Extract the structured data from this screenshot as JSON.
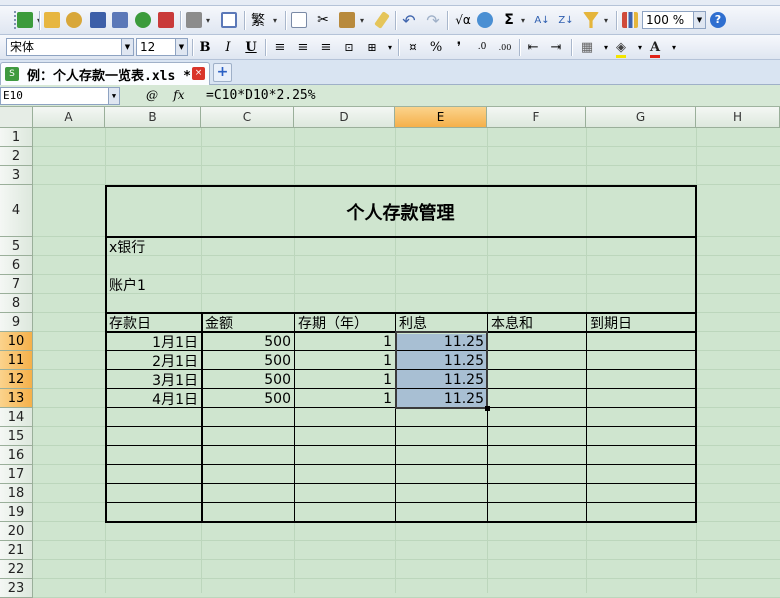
{
  "toolbar": {
    "zoom": "100 %",
    "text_style_btn": "繁",
    "sum_btn": "Σ"
  },
  "format": {
    "font_name": "宋体",
    "font_size": "12",
    "bold": "B",
    "italic": "I",
    "underline": "U",
    "percent": "%",
    "inc_decimal": ".0",
    "dec_decimal": ".00",
    "font_color_btn": "A"
  },
  "doc_tab": {
    "icon": "S",
    "title": "例：个人存款一览表.xls *",
    "close": "×",
    "new_tab": "+"
  },
  "formula_bar": {
    "name_box": "E10",
    "fx_label": "fx",
    "zoom_icon": "@",
    "formula": "=C10*D10*2.25%"
  },
  "sheet": {
    "columns": [
      "A",
      "B",
      "C",
      "D",
      "E",
      "F",
      "G",
      "H"
    ],
    "selected_column": "E",
    "rows": [
      "1",
      "2",
      "3",
      "4",
      "5",
      "6",
      "7",
      "8",
      "9",
      "10",
      "11",
      "12",
      "13",
      "14",
      "15",
      "16",
      "17",
      "18",
      "19",
      "20",
      "21",
      "22",
      "23"
    ],
    "selected_rows": [
      "10",
      "11",
      "12",
      "13"
    ],
    "table_title": "个人存款管理",
    "bank": "x银行",
    "account": "账户1",
    "headers": [
      "存款日",
      "金额",
      "存期（年）",
      "利息",
      "本息和",
      "到期日"
    ],
    "data": [
      {
        "date": "1月1日",
        "amount": "500",
        "term": "1",
        "interest": "11.25"
      },
      {
        "date": "2月1日",
        "amount": "500",
        "term": "1",
        "interest": "11.25"
      },
      {
        "date": "3月1日",
        "amount": "500",
        "term": "1",
        "interest": "11.25"
      },
      {
        "date": "4月1日",
        "amount": "500",
        "term": "1",
        "interest": "11.25"
      }
    ]
  },
  "colors": {
    "sheet_bg": "#cfe5cf",
    "selection": "#a8bfd3",
    "header_selected": "#f5b04a"
  }
}
